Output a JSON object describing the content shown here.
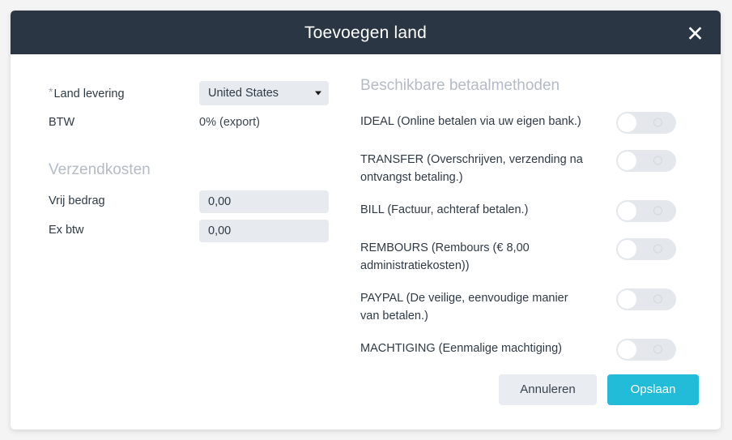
{
  "modal": {
    "title": "Toevoegen land",
    "close_icon": "close-icon"
  },
  "left": {
    "country_label": "Land levering",
    "required_marker": "*",
    "country_value": "United States",
    "vat_label": "BTW",
    "vat_value": "0% (export)",
    "shipping_section": "Verzendkosten",
    "free_amount_label": "Vrij bedrag",
    "free_amount_value": "0,00",
    "ex_vat_label": "Ex btw",
    "ex_vat_value": "0,00"
  },
  "right": {
    "section": "Beschikbare betaalmethoden",
    "methods": [
      {
        "label": "IDEAL (Online betalen via uw eigen bank.)",
        "enabled": false
      },
      {
        "label": "TRANSFER (Overschrijven, verzending na ontvangst betaling.)",
        "enabled": false
      },
      {
        "label": "BILL (Factuur, achteraf betalen.)",
        "enabled": false
      },
      {
        "label": "REMBOURS (Rembours (€ 8,00 administratiekosten))",
        "enabled": false
      },
      {
        "label": "PAYPAL (De veilige, eenvoudige manier van betalen.)",
        "enabled": false
      },
      {
        "label": "MACHTIGING (Eenmalige machtiging)",
        "enabled": false
      }
    ]
  },
  "footer": {
    "cancel_label": "Annuleren",
    "save_label": "Opslaan"
  },
  "colors": {
    "header_bg": "#2b3644",
    "accent": "#22bcd8",
    "field_bg": "#e7eaef",
    "section_text": "#b4bbc6",
    "cancel_bg": "#e9ecf0"
  }
}
